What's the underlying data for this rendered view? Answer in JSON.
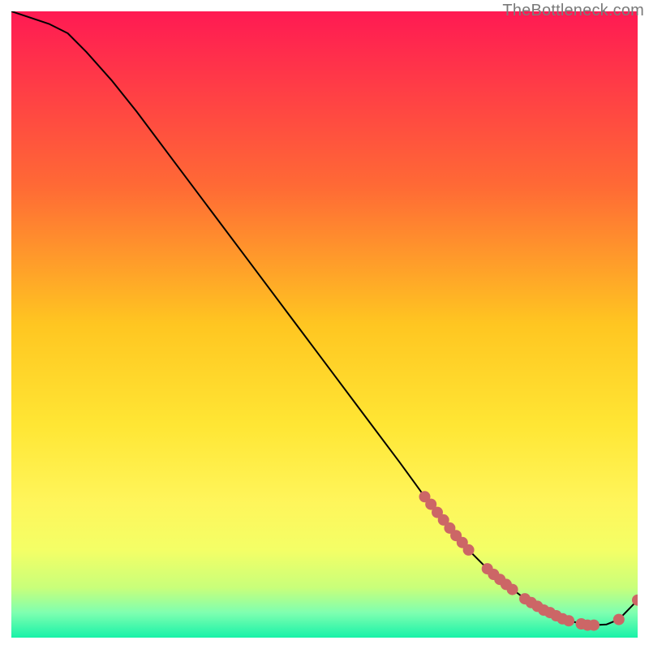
{
  "attribution": "TheBottleneck.com",
  "chart_data": {
    "type": "line",
    "title": "",
    "xlabel": "",
    "ylabel": "",
    "xlim": [
      0,
      100
    ],
    "ylim": [
      0,
      100
    ],
    "background_gradient": {
      "stops": [
        {
          "offset": 0.0,
          "color": "#ff1a53"
        },
        {
          "offset": 0.28,
          "color": "#ff6a35"
        },
        {
          "offset": 0.5,
          "color": "#ffc621"
        },
        {
          "offset": 0.66,
          "color": "#ffe634"
        },
        {
          "offset": 0.78,
          "color": "#fff55a"
        },
        {
          "offset": 0.86,
          "color": "#f4ff66"
        },
        {
          "offset": 0.92,
          "color": "#c9ff7a"
        },
        {
          "offset": 0.96,
          "color": "#7fffb0"
        },
        {
          "offset": 1.0,
          "color": "#18f2a8"
        }
      ]
    },
    "series": [
      {
        "name": "curve",
        "color": "#000000",
        "x": [
          0,
          3,
          6,
          9,
          12,
          16,
          20,
          26,
          32,
          38,
          44,
          50,
          56,
          62,
          66,
          70,
          73,
          76,
          79,
          82,
          85,
          88,
          91,
          93,
          95,
          97,
          100
        ],
        "y": [
          100,
          99,
          98,
          96.5,
          93.5,
          89,
          84,
          76,
          68,
          60,
          52,
          44,
          36,
          28,
          22.5,
          17.5,
          14,
          11,
          8.5,
          6.2,
          4.4,
          3.0,
          2.2,
          2.0,
          2.1,
          2.9,
          6.0
        ]
      }
    ],
    "markers": [
      {
        "name": "highlight-dots",
        "color": "#cc6666",
        "radius": 7,
        "x": [
          66,
          67,
          68,
          69,
          70,
          71,
          72,
          73,
          76,
          77,
          78,
          79,
          80,
          82,
          83,
          84,
          85,
          86,
          87,
          88,
          89,
          91,
          92,
          93,
          97,
          100
        ],
        "y": [
          22.5,
          21.3,
          20.0,
          18.8,
          17.5,
          16.3,
          15.2,
          14.0,
          11.0,
          10.1,
          9.3,
          8.5,
          7.7,
          6.2,
          5.6,
          5.0,
          4.4,
          4.0,
          3.5,
          3.0,
          2.7,
          2.2,
          2.0,
          2.0,
          2.9,
          6.0
        ]
      }
    ]
  }
}
